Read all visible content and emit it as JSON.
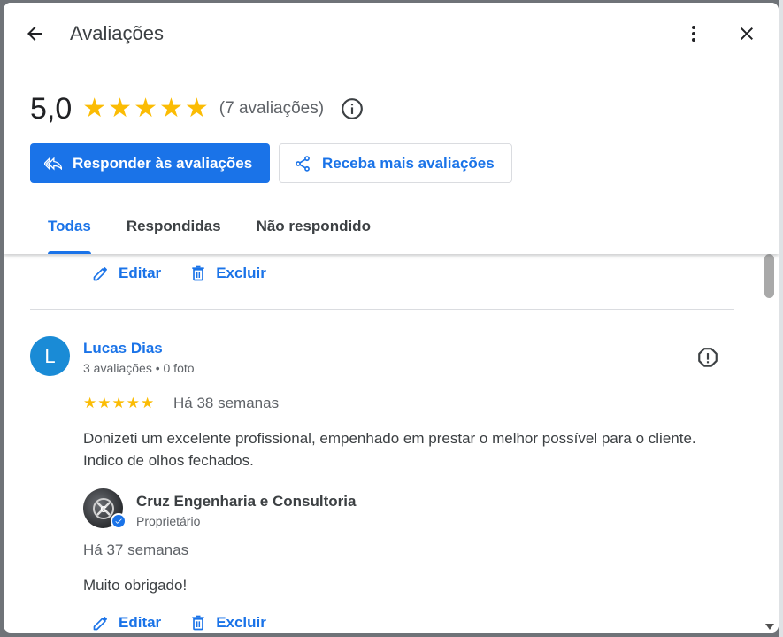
{
  "header": {
    "title": "Avaliações",
    "back_icon": "arrow-back-icon",
    "more_icon": "more-vert-icon",
    "close_icon": "close-icon"
  },
  "summary": {
    "rating": "5,0",
    "stars": 5,
    "count_text": "(7 avaliações)",
    "star_color": "#fbbc04"
  },
  "buttons": {
    "reply_label": "Responder às avaliações",
    "get_more_label": "Receba mais avaliações",
    "accent": "#1a73e8"
  },
  "tabs": [
    {
      "label": "Todas",
      "active": true
    },
    {
      "label": "Respondidas",
      "active": false
    },
    {
      "label": "Não respondido",
      "active": false
    }
  ],
  "prev_review_actions": {
    "edit_label": "Editar",
    "delete_label": "Excluir"
  },
  "review": {
    "avatar_letter": "L",
    "name": "Lucas Dias",
    "meta": "3 avaliações • 0 foto",
    "stars": 5,
    "time": "Há 38 semanas",
    "text": "Donizeti um excelente profissional, empenhado em prestar o melhor possível para o cliente. Indico de olhos fechados.",
    "reply": {
      "owner_name": "Cruz Engenharia e Consultoria",
      "owner_role": "Proprietário",
      "time": "Há 37 semanas",
      "text": "Muito obrigado!"
    },
    "actions": {
      "edit_label": "Editar",
      "delete_label": "Excluir"
    }
  }
}
